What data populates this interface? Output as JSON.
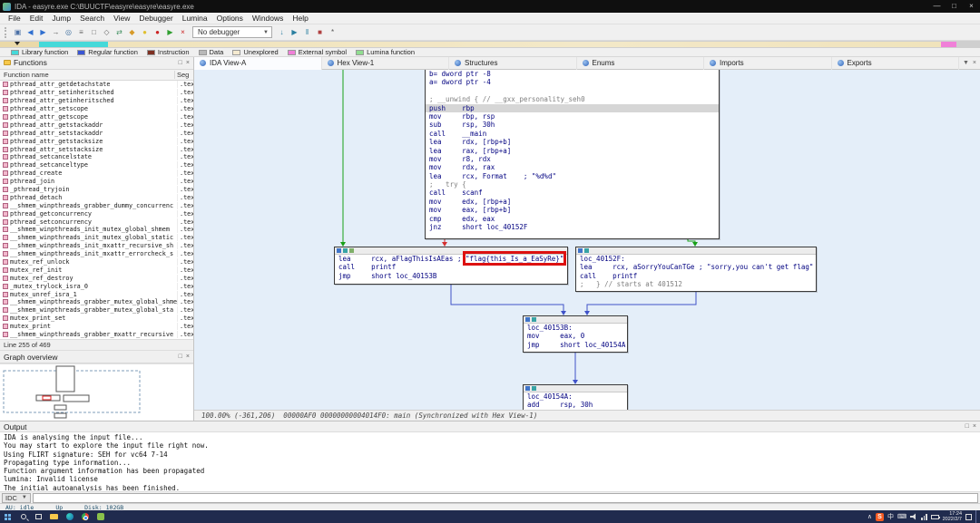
{
  "titlebar": {
    "title": "IDA - easyre.exe C:\\BUUCTF\\easyre\\easyre\\easyre.exe",
    "minimize": "—",
    "maximize": "□",
    "close": "×"
  },
  "menu": [
    {
      "label": "File",
      "name": "menu-file"
    },
    {
      "label": "Edit",
      "name": "menu-edit"
    },
    {
      "label": "Jump",
      "name": "menu-jump"
    },
    {
      "label": "Search",
      "name": "menu-search"
    },
    {
      "label": "View",
      "name": "menu-view"
    },
    {
      "label": "Debugger",
      "name": "menu-debugger"
    },
    {
      "label": "Lumina",
      "name": "menu-lumina"
    },
    {
      "label": "Options",
      "name": "menu-options"
    },
    {
      "label": "Windows",
      "name": "menu-windows"
    },
    {
      "label": "Help",
      "name": "menu-help"
    }
  ],
  "toolbar": {
    "debugger_combo": "No debugger",
    "icons_left": [
      {
        "name": "save-icon",
        "g": "▣",
        "c": "#4a6fa5"
      },
      {
        "name": "back-icon",
        "g": "◀",
        "c": "#2f6fd0"
      },
      {
        "name": "forward-icon",
        "g": "▶",
        "c": "#2f6fd0"
      },
      {
        "name": "jump-address-icon",
        "g": "→",
        "c": "#555555"
      },
      {
        "name": "search-icon",
        "g": "◎",
        "c": "#3f6f9f"
      },
      {
        "name": "names-list-icon",
        "g": "≡",
        "c": "#666666"
      },
      {
        "name": "structures-icon",
        "g": "□",
        "c": "#666666"
      },
      {
        "name": "enums-icon",
        "g": "◇",
        "c": "#666666"
      },
      {
        "name": "xrefs-icon",
        "g": "⇄",
        "c": "#3f8f5f"
      },
      {
        "name": "colorize-icon",
        "g": "◆",
        "c": "#d79b2a"
      },
      {
        "name": "bookmark-icon",
        "g": "●",
        "c": "#e0c030"
      },
      {
        "name": "breakpoint-icon",
        "g": "●",
        "c": "#cc2222"
      },
      {
        "name": "run-icon",
        "g": "▶",
        "c": "#2f9f2f"
      },
      {
        "name": "cancel-icon",
        "g": "×",
        "c": "#cc2222"
      }
    ],
    "icons_right": [
      {
        "name": "debug-attach-icon",
        "g": "↓",
        "c": "#2a7fa0"
      },
      {
        "name": "debug-run-icon",
        "g": "▶",
        "c": "#2a7fa0"
      },
      {
        "name": "debug-pause-icon",
        "g": "‖",
        "c": "#2a7fa0"
      },
      {
        "name": "debug-stop-icon",
        "g": "■",
        "c": "#b04040"
      },
      {
        "name": "options-icon",
        "g": "*",
        "c": "#555555"
      }
    ]
  },
  "legend": [
    {
      "label": "Library function",
      "color": "#45d9d9"
    },
    {
      "label": "Regular function",
      "color": "#3a56d4"
    },
    {
      "label": "Instruction",
      "color": "#7e3022"
    },
    {
      "label": "Data",
      "color": "#b8b8b8"
    },
    {
      "label": "Unexplored",
      "color": "#f5ead0"
    },
    {
      "label": "External symbol",
      "color": "#f080d8"
    },
    {
      "label": "Lumina function",
      "color": "#90dd90"
    }
  ],
  "tabs": [
    {
      "label": "IDA View-A",
      "name": "tab-ida-view-a",
      "state": "active"
    },
    {
      "label": "Hex View-1",
      "name": "tab-hex-view-1",
      "state": ""
    },
    {
      "label": "Structures",
      "name": "tab-structures",
      "state": ""
    },
    {
      "label": "Enums",
      "name": "tab-enums",
      "state": ""
    },
    {
      "label": "Imports",
      "name": "tab-imports",
      "state": ""
    },
    {
      "label": "Exports",
      "name": "tab-exports",
      "state": ""
    }
  ],
  "functions_panel": {
    "title": "Functions",
    "col1": "Function name",
    "col2": "Seg",
    "footer": "Line 255 of 469",
    "rows": [
      {
        "n": "pthread_attr_getdetachstate",
        "s": ".text"
      },
      {
        "n": "pthread_attr_setinheritsched",
        "s": ".text"
      },
      {
        "n": "pthread_attr_getinheritsched",
        "s": ".text"
      },
      {
        "n": "pthread_attr_setscope",
        "s": ".text"
      },
      {
        "n": "pthread_attr_getscope",
        "s": ".text"
      },
      {
        "n": "pthread_attr_getstackaddr",
        "s": ".text"
      },
      {
        "n": "pthread_attr_setstackaddr",
        "s": ".text"
      },
      {
        "n": "pthread_attr_getstacksize",
        "s": ".text"
      },
      {
        "n": "pthread_attr_setstacksize",
        "s": ".text"
      },
      {
        "n": "pthread_setcancelstate",
        "s": ".text"
      },
      {
        "n": "pthread_setcanceltype",
        "s": ".text"
      },
      {
        "n": "pthread_create",
        "s": ".text"
      },
      {
        "n": "pthread_join",
        "s": ".text"
      },
      {
        "n": "_pthread_tryjoin",
        "s": ".text"
      },
      {
        "n": "pthread_detach",
        "s": ".text"
      },
      {
        "n": "__shmem_winpthreads_grabber_dummy_concurrenc",
        "s": ".text"
      },
      {
        "n": "pthread_getconcurrency",
        "s": ".text"
      },
      {
        "n": "pthread_setconcurrency",
        "s": ".text"
      },
      {
        "n": "__shmem_winpthreads_init_mutex_global_shmem",
        "s": ".text"
      },
      {
        "n": "__shmem_winpthreads_init_mutex_global_static",
        "s": ".text"
      },
      {
        "n": "__shmem_winpthreads_init_mxattr_recursive_sh",
        "s": ".text"
      },
      {
        "n": "__shmem_winpthreads_init_mxattr_errorcheck_s",
        "s": ".text"
      },
      {
        "n": "mutex_ref_unlock",
        "s": ".text"
      },
      {
        "n": "mutex_ref_init",
        "s": ".text"
      },
      {
        "n": "mutex_ref_destroy",
        "s": ".text"
      },
      {
        "n": "_mutex_trylock_isra_0",
        "s": ".text"
      },
      {
        "n": "mutex_unref_isra_1",
        "s": ".text"
      },
      {
        "n": "__shmem_winpthreads_grabber_mutex_global_shmem",
        "s": ".text"
      },
      {
        "n": "__shmem_winpthreads_grabber_mutex_global_sta",
        "s": ".text"
      },
      {
        "n": "mutex_print_set",
        "s": ".text"
      },
      {
        "n": "mutex_print",
        "s": ".text"
      },
      {
        "n": "__shmem_winpthreads_grabber_mxattr_recursive",
        "s": ".text"
      }
    ]
  },
  "graph_overview": {
    "title": "Graph overview"
  },
  "graph": {
    "status": "100.00% (-361,206)  00000AF0 00000000004014F0: main (Synchronized with Hex View-1)",
    "edge_colors": {
      "taken": "#18a018",
      "not_taken": "#d43030",
      "unconditional": "#4052c8"
    },
    "highlight_box_color": "#dd1111",
    "blocks": {
      "b1": {
        "lines": [
          {
            "t": "b= dword ptr -8",
            "c": "code"
          },
          {
            "t": "a= dword ptr -4",
            "c": "code"
          },
          {
            "t": "",
            "c": "code"
          },
          {
            "t": "; __unwind { // __gxx_personality_seh0",
            "c": "comment"
          },
          {
            "t": "push    rbp",
            "c": "code hl"
          },
          {
            "t": "mov     rbp, rsp",
            "c": "code"
          },
          {
            "t": "sub     rsp, 30h",
            "c": "code"
          },
          {
            "t": "call    __main",
            "c": "code"
          },
          {
            "t": "lea     rdx, [rbp+b]",
            "c": "code"
          },
          {
            "t": "lea     rax, [rbp+a]",
            "c": "code"
          },
          {
            "t": "mov     r8, rdx",
            "c": "code"
          },
          {
            "t": "mov     rdx, rax",
            "c": "code"
          },
          {
            "t": "lea     rcx, Format    ; \"%d%d\"",
            "c": "code"
          },
          {
            "t": ";   try {",
            "c": "comment"
          },
          {
            "t": "call    scanf",
            "c": "code"
          },
          {
            "t": "mov     edx, [rbp+a]",
            "c": "code"
          },
          {
            "t": "mov     eax, [rbp+b]",
            "c": "code"
          },
          {
            "t": "cmp     edx, eax",
            "c": "code"
          },
          {
            "t": "jnz     short loc_40152F",
            "c": "code"
          }
        ]
      },
      "b2": {
        "lines": [
          {
            "t": "lea     rcx, aFlagThisIsAEas ; \"flag{this_Is_a_EaSyRe}\"",
            "c": "code"
          },
          {
            "t": "call    printf",
            "c": "code"
          },
          {
            "t": "jmp     short loc_40153B",
            "c": "code"
          }
        ]
      },
      "b3": {
        "lines": [
          {
            "t": "loc_40152F:",
            "c": "code"
          },
          {
            "t": "lea     rcx, aSorryYouCanTGe ; \"sorry,you can't get flag\"",
            "c": "code"
          },
          {
            "t": "call    printf",
            "c": "code"
          },
          {
            "t": ";   } // starts at 401512",
            "c": "comment"
          }
        ]
      },
      "b4": {
        "lines": [
          {
            "t": "loc_40153B:",
            "c": "code"
          },
          {
            "t": "mov     eax, 0",
            "c": "code"
          },
          {
            "t": "jmp     short loc_40154A",
            "c": "code"
          }
        ]
      },
      "b5": {
        "lines": [
          {
            "t": "loc_40154A:",
            "c": "code"
          },
          {
            "t": "add     rsp, 30h",
            "c": "code"
          }
        ]
      }
    }
  },
  "output_panel": {
    "title": "Output",
    "lines": [
      "IDA is analysing the input file...",
      "You may start to explore the input file right now.",
      "Using FLIRT signature: SEH for vc64 7-14",
      "Propagating type information...",
      "Function argument information has been propagated",
      "lumina: Invalid license",
      "The initial autoanalysis has been finished."
    ],
    "cli_label": "IDC"
  },
  "statusbar": {
    "au": "AU: idle",
    "up": "Up",
    "disk": "Disk: 102GB"
  },
  "taskbar": {
    "time": "17:24",
    "date": "2022/2/7",
    "lang": "中",
    "sogou": "S",
    "expand": "∧"
  }
}
